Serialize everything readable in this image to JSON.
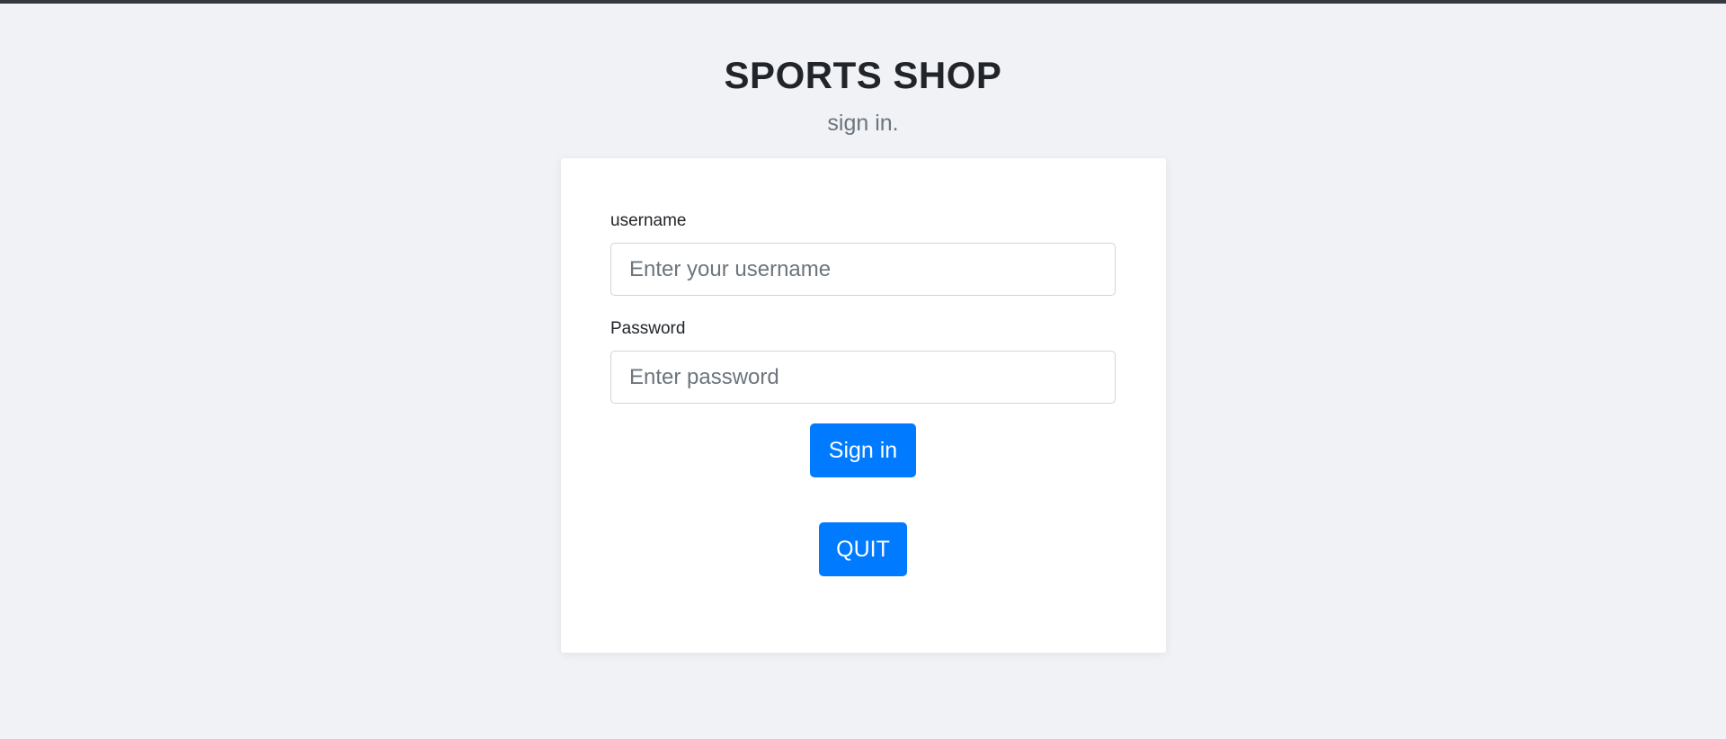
{
  "header": {
    "title": "SPORTS SHOP",
    "subtitle": "sign in."
  },
  "form": {
    "username": {
      "label": "username",
      "placeholder": "Enter your username",
      "value": ""
    },
    "password": {
      "label": "Password",
      "placeholder": "Enter password",
      "value": ""
    },
    "signin_label": "Sign in",
    "quit_label": "QUIT"
  },
  "colors": {
    "background": "#f0f2f6",
    "top_bar": "#343a40",
    "primary_button": "#007bff",
    "card": "#ffffff"
  }
}
